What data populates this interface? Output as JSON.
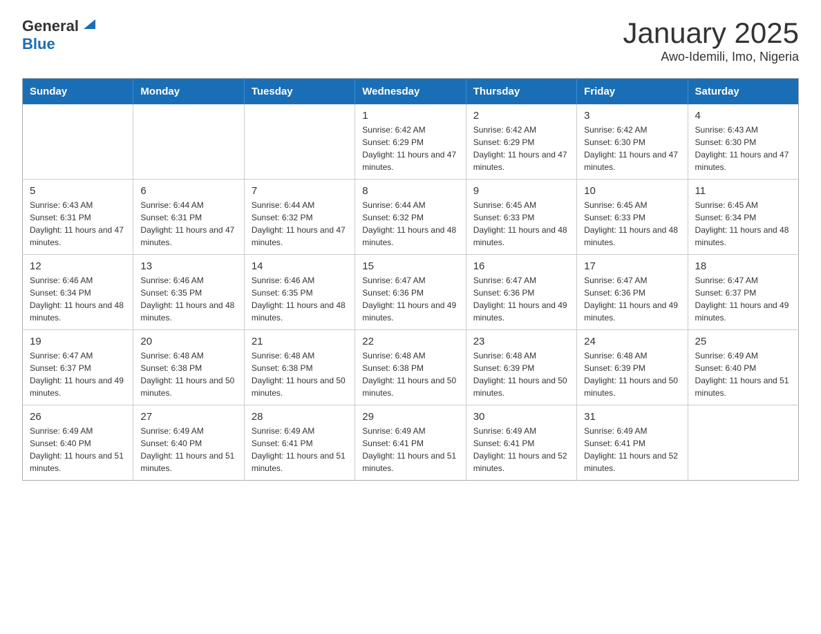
{
  "header": {
    "logo_general": "General",
    "logo_blue": "Blue",
    "month_title": "January 2025",
    "location": "Awo-Idemili, Imo, Nigeria"
  },
  "days_of_week": [
    "Sunday",
    "Monday",
    "Tuesday",
    "Wednesday",
    "Thursday",
    "Friday",
    "Saturday"
  ],
  "weeks": [
    [
      {
        "day": "",
        "info": ""
      },
      {
        "day": "",
        "info": ""
      },
      {
        "day": "",
        "info": ""
      },
      {
        "day": "1",
        "info": "Sunrise: 6:42 AM\nSunset: 6:29 PM\nDaylight: 11 hours and 47 minutes."
      },
      {
        "day": "2",
        "info": "Sunrise: 6:42 AM\nSunset: 6:29 PM\nDaylight: 11 hours and 47 minutes."
      },
      {
        "day": "3",
        "info": "Sunrise: 6:42 AM\nSunset: 6:30 PM\nDaylight: 11 hours and 47 minutes."
      },
      {
        "day": "4",
        "info": "Sunrise: 6:43 AM\nSunset: 6:30 PM\nDaylight: 11 hours and 47 minutes."
      }
    ],
    [
      {
        "day": "5",
        "info": "Sunrise: 6:43 AM\nSunset: 6:31 PM\nDaylight: 11 hours and 47 minutes."
      },
      {
        "day": "6",
        "info": "Sunrise: 6:44 AM\nSunset: 6:31 PM\nDaylight: 11 hours and 47 minutes."
      },
      {
        "day": "7",
        "info": "Sunrise: 6:44 AM\nSunset: 6:32 PM\nDaylight: 11 hours and 47 minutes."
      },
      {
        "day": "8",
        "info": "Sunrise: 6:44 AM\nSunset: 6:32 PM\nDaylight: 11 hours and 48 minutes."
      },
      {
        "day": "9",
        "info": "Sunrise: 6:45 AM\nSunset: 6:33 PM\nDaylight: 11 hours and 48 minutes."
      },
      {
        "day": "10",
        "info": "Sunrise: 6:45 AM\nSunset: 6:33 PM\nDaylight: 11 hours and 48 minutes."
      },
      {
        "day": "11",
        "info": "Sunrise: 6:45 AM\nSunset: 6:34 PM\nDaylight: 11 hours and 48 minutes."
      }
    ],
    [
      {
        "day": "12",
        "info": "Sunrise: 6:46 AM\nSunset: 6:34 PM\nDaylight: 11 hours and 48 minutes."
      },
      {
        "day": "13",
        "info": "Sunrise: 6:46 AM\nSunset: 6:35 PM\nDaylight: 11 hours and 48 minutes."
      },
      {
        "day": "14",
        "info": "Sunrise: 6:46 AM\nSunset: 6:35 PM\nDaylight: 11 hours and 48 minutes."
      },
      {
        "day": "15",
        "info": "Sunrise: 6:47 AM\nSunset: 6:36 PM\nDaylight: 11 hours and 49 minutes."
      },
      {
        "day": "16",
        "info": "Sunrise: 6:47 AM\nSunset: 6:36 PM\nDaylight: 11 hours and 49 minutes."
      },
      {
        "day": "17",
        "info": "Sunrise: 6:47 AM\nSunset: 6:36 PM\nDaylight: 11 hours and 49 minutes."
      },
      {
        "day": "18",
        "info": "Sunrise: 6:47 AM\nSunset: 6:37 PM\nDaylight: 11 hours and 49 minutes."
      }
    ],
    [
      {
        "day": "19",
        "info": "Sunrise: 6:47 AM\nSunset: 6:37 PM\nDaylight: 11 hours and 49 minutes."
      },
      {
        "day": "20",
        "info": "Sunrise: 6:48 AM\nSunset: 6:38 PM\nDaylight: 11 hours and 50 minutes."
      },
      {
        "day": "21",
        "info": "Sunrise: 6:48 AM\nSunset: 6:38 PM\nDaylight: 11 hours and 50 minutes."
      },
      {
        "day": "22",
        "info": "Sunrise: 6:48 AM\nSunset: 6:38 PM\nDaylight: 11 hours and 50 minutes."
      },
      {
        "day": "23",
        "info": "Sunrise: 6:48 AM\nSunset: 6:39 PM\nDaylight: 11 hours and 50 minutes."
      },
      {
        "day": "24",
        "info": "Sunrise: 6:48 AM\nSunset: 6:39 PM\nDaylight: 11 hours and 50 minutes."
      },
      {
        "day": "25",
        "info": "Sunrise: 6:49 AM\nSunset: 6:40 PM\nDaylight: 11 hours and 51 minutes."
      }
    ],
    [
      {
        "day": "26",
        "info": "Sunrise: 6:49 AM\nSunset: 6:40 PM\nDaylight: 11 hours and 51 minutes."
      },
      {
        "day": "27",
        "info": "Sunrise: 6:49 AM\nSunset: 6:40 PM\nDaylight: 11 hours and 51 minutes."
      },
      {
        "day": "28",
        "info": "Sunrise: 6:49 AM\nSunset: 6:41 PM\nDaylight: 11 hours and 51 minutes."
      },
      {
        "day": "29",
        "info": "Sunrise: 6:49 AM\nSunset: 6:41 PM\nDaylight: 11 hours and 51 minutes."
      },
      {
        "day": "30",
        "info": "Sunrise: 6:49 AM\nSunset: 6:41 PM\nDaylight: 11 hours and 52 minutes."
      },
      {
        "day": "31",
        "info": "Sunrise: 6:49 AM\nSunset: 6:41 PM\nDaylight: 11 hours and 52 minutes."
      },
      {
        "day": "",
        "info": ""
      }
    ]
  ]
}
